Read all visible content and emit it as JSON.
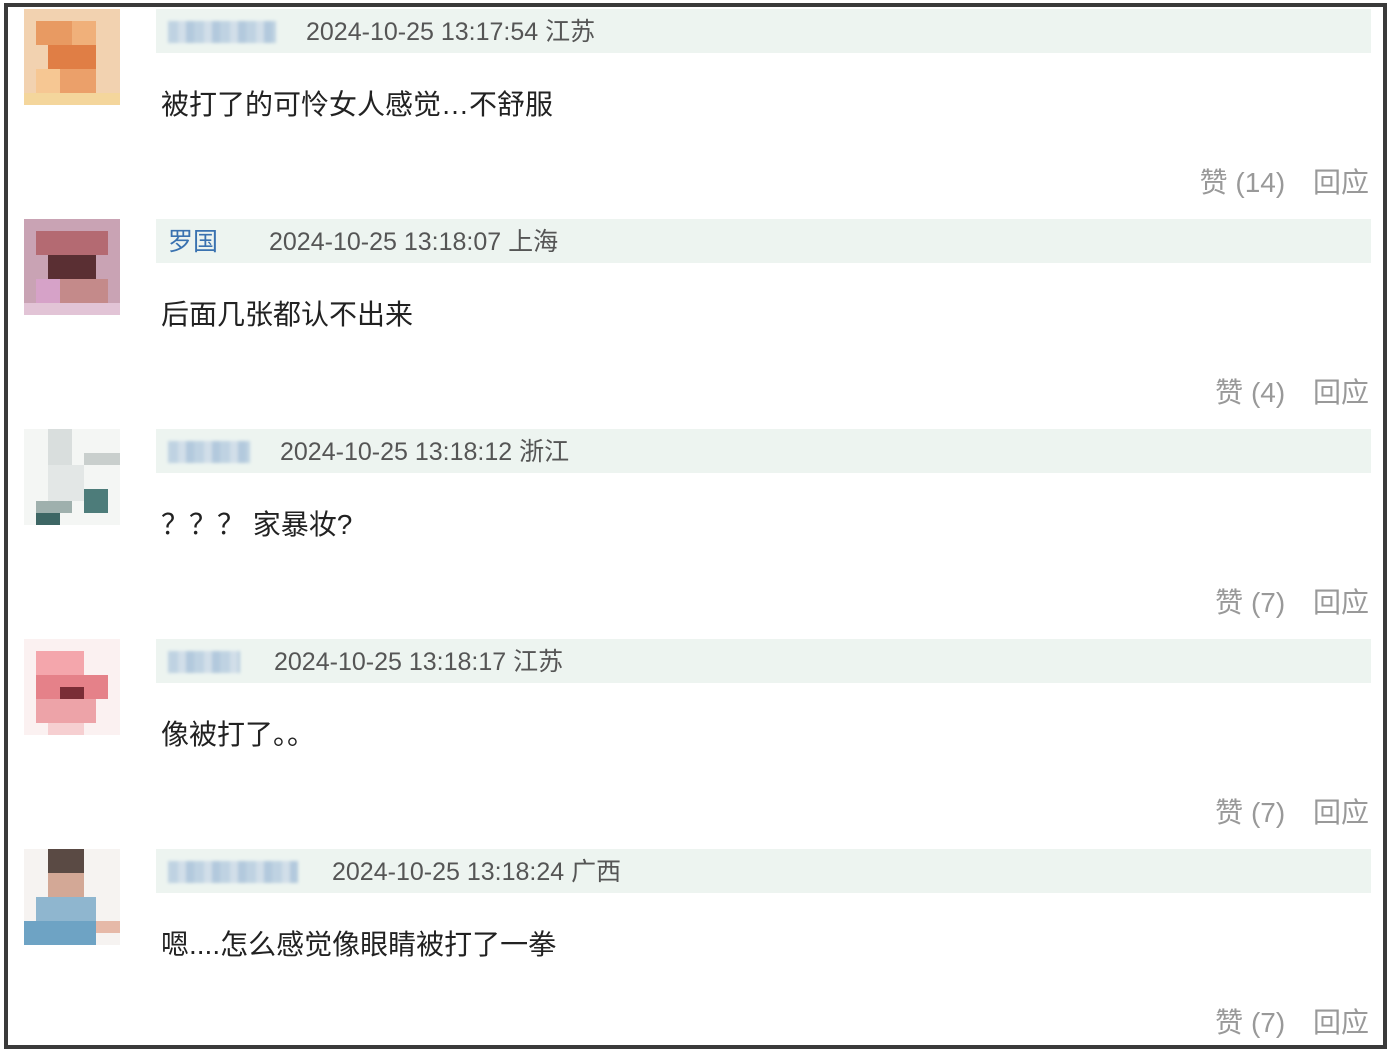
{
  "comments": [
    {
      "time": "2024-10-25 13:17:54",
      "location": "江苏",
      "text": "被打了的可怜女人感觉…不舒服",
      "like_label": "赞",
      "likes": "(14)",
      "reply_label": "回应"
    },
    {
      "username_partial": "罗国",
      "time": "2024-10-25 13:18:07",
      "location": "上海",
      "text": "后面几张都认不出来",
      "like_label": "赞",
      "likes": "(4)",
      "reply_label": "回应"
    },
    {
      "time": "2024-10-25 13:18:12",
      "location": "浙江",
      "text": "？？？ 家暴妆?",
      "like_label": "赞",
      "likes": "(7)",
      "reply_label": "回应"
    },
    {
      "time": "2024-10-25 13:18:17",
      "location": "江苏",
      "text": "像被打了。。",
      "like_label": "赞",
      "likes": "(7)",
      "reply_label": "回应"
    },
    {
      "time": "2024-10-25 13:18:24",
      "location": "广西",
      "text": "嗯....怎么感觉像眼睛被打了一拳",
      "like_label": "赞",
      "likes": "(7)",
      "reply_label": "回应"
    }
  ]
}
